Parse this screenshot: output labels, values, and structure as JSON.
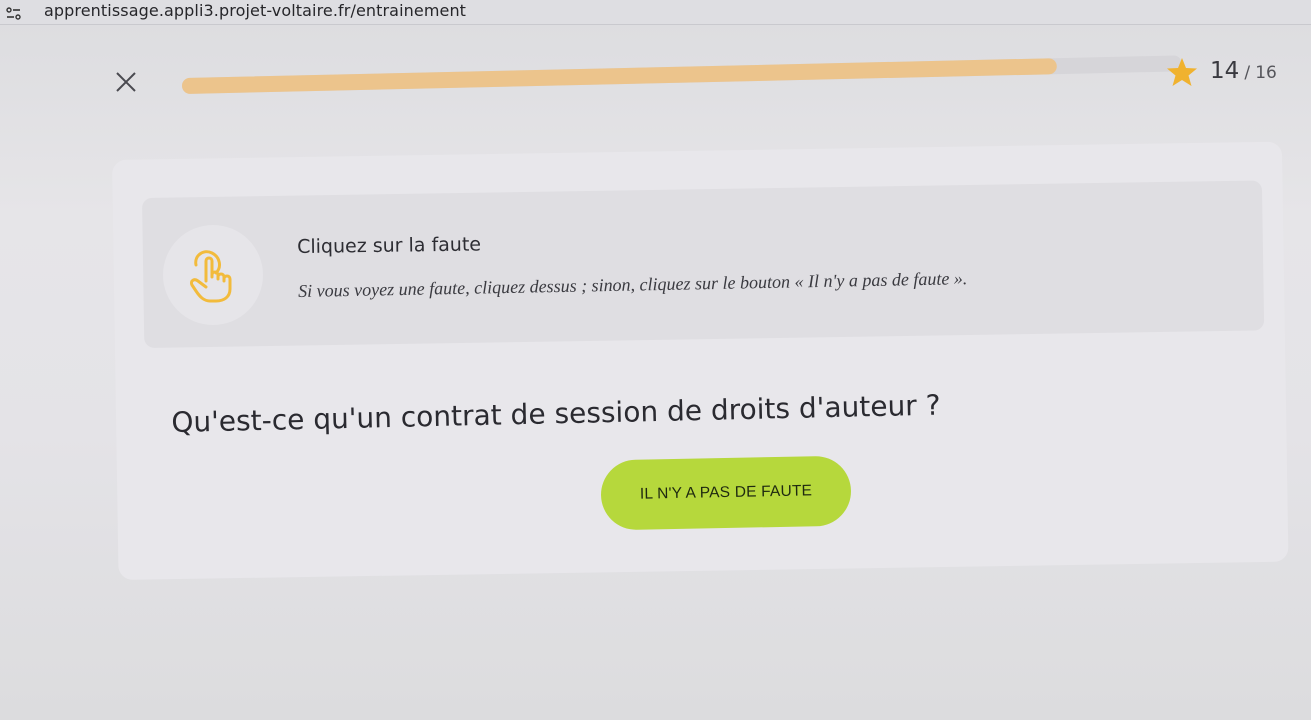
{
  "browser": {
    "url": "apprentissage.appli3.projet-voltaire.fr/entrainement",
    "site_settings_icon": "site-settings-icon"
  },
  "header": {
    "close_icon": "close-icon",
    "progress": {
      "current": 14,
      "total": 16,
      "fraction": 0.875,
      "fill_color": "#ecc48c",
      "track_color": "#d6d5d9"
    },
    "star_icon": "star-icon",
    "star_color": "#f0b22f",
    "score_current": "14",
    "score_separator": "/",
    "score_total": "16"
  },
  "instruction": {
    "icon": "pointing-hand-icon",
    "icon_color": "#f2bb3c",
    "title": "Cliquez sur la faute",
    "text": "Si vous voyez une faute, cliquez dessus ; sinon, cliquez sur le bouton « Il n'y a pas de faute »."
  },
  "exercise": {
    "sentence": "Qu'est-ce qu'un contrat de session de droits d'auteur ?",
    "no_fault_button_label": "IL N'Y A PAS DE FAUTE",
    "button_color": "#b6d83c"
  }
}
